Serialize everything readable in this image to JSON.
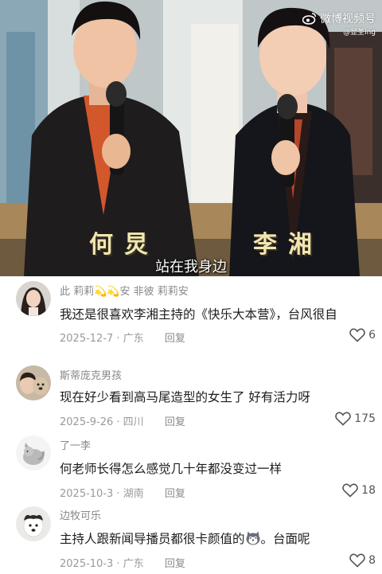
{
  "video": {
    "watermark": "微博视频号",
    "watermark_sub": "@显圣ing",
    "host_left_name": "何炅",
    "host_right_name": "李湘",
    "subtitle": "站在我身边"
  },
  "comments": [
    {
      "username": "此 莉莉💫💫安 非彼 莉莉安",
      "text": "我还是很喜欢李湘主持的《快乐大本营》，台风很自",
      "date": "2025-12-7 · 广东",
      "reply": "回复",
      "likes": "6"
    },
    {
      "username": "斯蒂庞克男孩",
      "text": "现在好少看到高马尾造型的女生了 好有活力呀",
      "date": "2025-9-26 · 四川",
      "reply": "回复",
      "likes": "175"
    },
    {
      "username": "了一李",
      "text": "何老师长得怎么感觉几十年都没变过一样",
      "date": "2025-10-3 · 湖南",
      "reply": "回复",
      "likes": "18"
    },
    {
      "username": "边牧可乐",
      "text_before_emoji": "主持人跟新闻导播员都很卡颜值的",
      "text_after_emoji": "。台面呢",
      "emoji_icon": "husky-emoji",
      "date": "2025-10-3 · 广东",
      "reply": "回复",
      "likes": "8"
    }
  ]
}
